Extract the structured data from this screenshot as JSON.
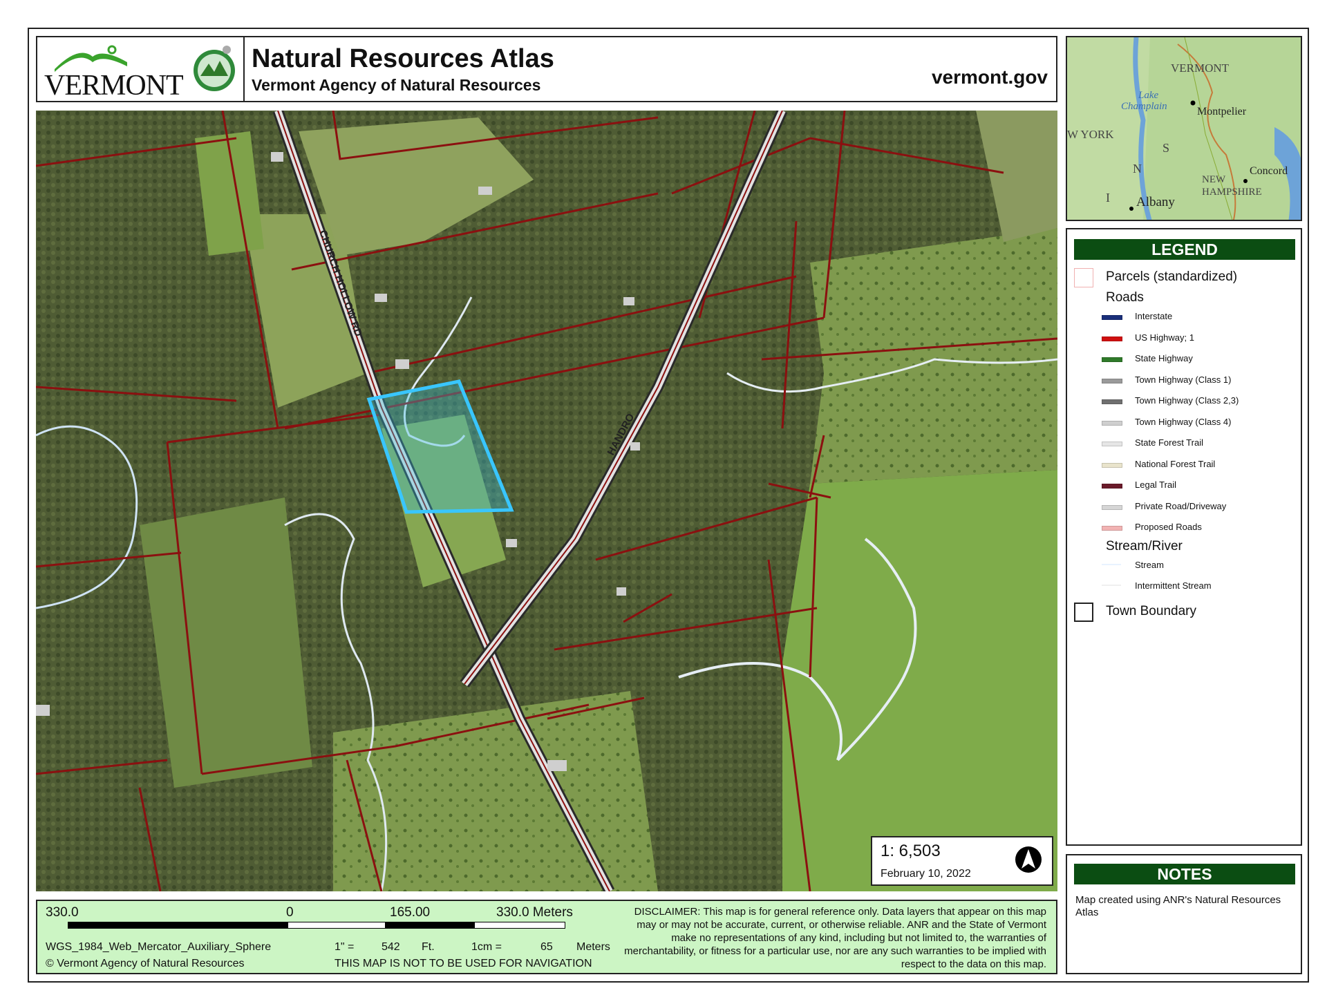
{
  "header": {
    "logo_text": "VERMONT",
    "title": "Natural Resources Atlas",
    "subtitle": "Vermont Agency of Natural Resources",
    "site": "vermont.gov"
  },
  "map": {
    "road_labels": [
      "CHURCH HOLLOW RD",
      "HANDRO"
    ],
    "colors": {
      "parcel_line": "#8b1010",
      "highlight": "#39c6ff",
      "forest": "#4c5a32",
      "field": "#8ea15c",
      "road": "#d9d9d9"
    }
  },
  "scale": {
    "ratio": "1:  6,503",
    "date": "February 10, 2022",
    "north_icon": "north-arrow-icon"
  },
  "inset": {
    "labels": [
      "VERMONT",
      "Lake",
      "Champlain",
      "Montpelier",
      "W YORK",
      "S",
      "N",
      "I",
      "NEW",
      "HAMPSHIRE",
      "Concord",
      "Albany"
    ]
  },
  "legend": {
    "title": "LEGEND",
    "parcels": "Parcels (standardized)",
    "roads_heading": "Roads",
    "roads": [
      {
        "label": "Interstate",
        "color": "#1a2f7a"
      },
      {
        "label": "US Highway; 1",
        "color": "#d01010"
      },
      {
        "label": "State Highway",
        "color": "#2f7a2a"
      },
      {
        "label": "Town Highway (Class 1)",
        "color": "#9a9a9a"
      },
      {
        "label": "Town Highway (Class 2,3)",
        "color": "#707070"
      },
      {
        "label": "Town Highway (Class 4)",
        "color": "#cfcfcf"
      },
      {
        "label": "State Forest Trail",
        "color": "#e6e6e6"
      },
      {
        "label": "National Forest Trail",
        "color": "#e9e4cc"
      },
      {
        "label": "Legal Trail",
        "color": "#6a1a2a"
      },
      {
        "label": "Private Road/Driveway",
        "color": "#d6d6d6"
      },
      {
        "label": "Proposed Roads",
        "color": "#f2b3b3"
      }
    ],
    "stream_heading": "Stream/River",
    "streams": [
      {
        "label": "Stream",
        "color": "#e8f3ff"
      },
      {
        "label": "Intermittent Stream",
        "color": "#f0f0f0"
      }
    ],
    "town_boundary": "Town Boundary"
  },
  "notes": {
    "title": "NOTES",
    "text": "Map created using ANR's Natural Resources Atlas"
  },
  "footer": {
    "scale_left": "330.0",
    "scale_zero": "0",
    "scale_mid": "165.00",
    "scale_right": "330.0 Meters",
    "projection": "WGS_1984_Web_Mercator_Auxiliary_Sphere",
    "copyright": "© Vermont Agency of Natural Resources",
    "inch_label": "1\" =",
    "inch_value": "542",
    "inch_unit": "Ft.",
    "cm_label": "1cm =",
    "cm_value": "65",
    "cm_unit": "Meters",
    "nav_warning": "THIS MAP IS NOT TO BE USED FOR NAVIGATION",
    "disclaimer": "DISCLAIMER: This map is for general reference only. Data layers that appear on this map may or may not be accurate, current, or otherwise reliable. ANR and the State of Vermont make no representations of any kind, including but not limited to, the warranties of merchantability, or fitness for a particular use, nor are any such warranties to be implied with respect to the data on this map."
  }
}
